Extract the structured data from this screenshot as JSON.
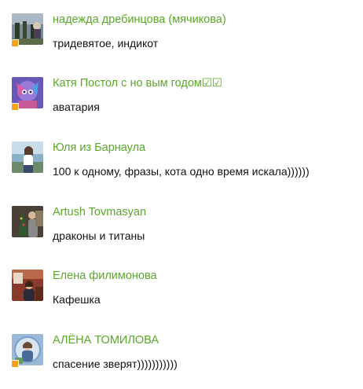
{
  "colors": {
    "name_link": "#5aa828",
    "message_text": "#111111",
    "status_dot": "#f4a21b"
  },
  "entries": [
    {
      "name": "надежда дребинцова (мячикова)",
      "message": "тридевятое, индикот",
      "avatar_icon": "user-photo-avatar",
      "status_icon": "online-status-icon"
    },
    {
      "name": "Катя Постол с но вым годом☑☑",
      "message": "аватария",
      "avatar_icon": "user-photo-avatar",
      "status_icon": "online-status-icon"
    },
    {
      "name": "Юля из Барнаула",
      "message": "100 к одному, фразы, кота одно время искала))))))",
      "avatar_icon": "user-photo-avatar",
      "status_icon": null
    },
    {
      "name": "Artush Tovmasyan",
      "message": "драконы и титаны",
      "avatar_icon": "user-photo-avatar",
      "status_icon": null
    },
    {
      "name": "Елена филимонова",
      "message": "Кафешка",
      "avatar_icon": "user-photo-avatar",
      "status_icon": null
    },
    {
      "name": "АЛЁНА ТОМИЛОВА",
      "message": "спасение зверят)))))))))))",
      "avatar_icon": "user-photo-avatar",
      "status_icon": "online-status-icon"
    }
  ]
}
